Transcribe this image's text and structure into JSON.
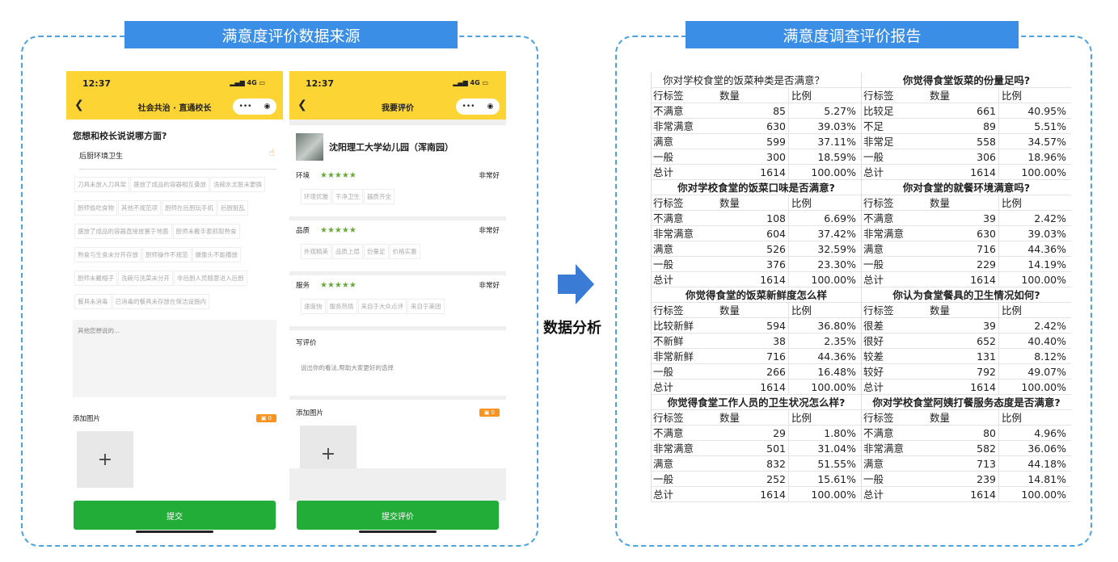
{
  "left_banner": "满意度评价数据来源",
  "right_banner": "满意度调查评价报告",
  "arrow_label": "数据分析",
  "phone1": {
    "time": "12:37",
    "signal": "4G",
    "title": "社会共治 · 直通校长",
    "caps": "•••",
    "question": "您想和校长说说哪方面?",
    "selected": "后厨环境卫生",
    "tags": [
      "刀具未放入刀具架",
      "盛放了成品的容器相互叠放",
      "洗碗水太脏未更换",
      "厨师偷吃食物",
      "其他不规范项",
      "厨师在后厨玩手机",
      "后厨脏乱",
      "盛放了成品的容器直接放置于地面",
      "厨师未戴手套抓取熟食",
      "熟食与生食未分开存放",
      "厨师操作不规范",
      "摄像头不能播放",
      "厨师未戴帽子",
      "洗碗与洗菜未分开",
      "非后厨人员随意进入后厨",
      "餐具未消毒",
      "已消毒的餐具未存放在保洁设施内"
    ],
    "textarea_placeholder": "其他您想说的...",
    "add_image": "添加图片",
    "image_count": "0",
    "plus": "+",
    "submit": "提交"
  },
  "phone2": {
    "time": "12:37",
    "signal": "4G",
    "title": "我要评价",
    "caps": "•••",
    "school": "沈阳理工大学幼儿园（浑南园）",
    "ratings": [
      {
        "label": "环境",
        "stars": "★★★★★",
        "value": "非常好",
        "tags": [
          "环境优雅",
          "干净卫生",
          "器质齐全"
        ]
      },
      {
        "label": "品质",
        "stars": "★★★★★",
        "value": "非常好",
        "tags": [
          "外观精美",
          "品质上层",
          "份量足",
          "价格实惠"
        ]
      },
      {
        "label": "服务",
        "stars": "★★★★★",
        "value": "非常好",
        "tags": [
          "速度快",
          "服务热情",
          "来自于大众点评",
          "来自于美团"
        ]
      }
    ],
    "write_label": "写评价",
    "write_hint": "说出你的看法,帮助大家更好的选择",
    "add_image": "添加图片",
    "image_count": "0",
    "plus": "+",
    "submit": "提交评价"
  },
  "report": {
    "col_headers": [
      "行标签",
      "数量",
      "比例"
    ],
    "left": [
      {
        "title": "你对学校食堂的饭菜种类是否满意？",
        "bold": false,
        "rows": [
          [
            "不满意",
            "85",
            "5.27%"
          ],
          [
            "非常满意",
            "630",
            "39.03%"
          ],
          [
            "满意",
            "599",
            "37.11%"
          ],
          [
            "一般",
            "300",
            "18.59%"
          ],
          [
            "总计",
            "1614",
            "100.00%"
          ]
        ]
      },
      {
        "title": "你对学校食堂的饭菜口味是否满意?",
        "bold": true,
        "rows": [
          [
            "不满意",
            "108",
            "6.69%"
          ],
          [
            "非常满意",
            "604",
            "37.42%"
          ],
          [
            "满意",
            "526",
            "32.59%"
          ],
          [
            "一般",
            "376",
            "23.30%"
          ],
          [
            "总计",
            "1614",
            "100.00%"
          ]
        ]
      },
      {
        "title": "你觉得食堂的饭菜新鲜度怎么样",
        "bold": true,
        "rows": [
          [
            "比较新鲜",
            "594",
            "36.80%"
          ],
          [
            "不新鲜",
            "38",
            "2.35%"
          ],
          [
            "非常新鲜",
            "716",
            "44.36%"
          ],
          [
            "一般",
            "266",
            "16.48%"
          ],
          [
            "总计",
            "1614",
            "100.00%"
          ]
        ]
      },
      {
        "title": "你觉得食堂工作人员的卫生状况怎么样?",
        "bold": true,
        "rows": [
          [
            "不满意",
            "29",
            "1.80%"
          ],
          [
            "非常满意",
            "501",
            "31.04%"
          ],
          [
            "满意",
            "832",
            "51.55%"
          ],
          [
            "一般",
            "252",
            "15.61%"
          ],
          [
            "总计",
            "1614",
            "100.00%"
          ]
        ]
      }
    ],
    "right": [
      {
        "title": "你觉得食堂饭菜的份量足吗?",
        "bold": true,
        "rows": [
          [
            "比较足",
            "661",
            "40.95%"
          ],
          [
            "不足",
            "89",
            "5.51%"
          ],
          [
            "非常足",
            "558",
            "34.57%"
          ],
          [
            "一般",
            "306",
            "18.96%"
          ],
          [
            "总计",
            "1614",
            "100.00%"
          ]
        ]
      },
      {
        "title": "你对食堂的就餐环境满意吗?",
        "bold": true,
        "rows": [
          [
            "不满意",
            "39",
            "2.42%"
          ],
          [
            "非常满意",
            "630",
            "39.03%"
          ],
          [
            "满意",
            "716",
            "44.36%"
          ],
          [
            "一般",
            "229",
            "14.19%"
          ],
          [
            "总计",
            "1614",
            "100.00%"
          ]
        ]
      },
      {
        "title": "你认为食堂餐具的卫生情况如何?",
        "bold": true,
        "rows": [
          [
            "很差",
            "39",
            "2.42%"
          ],
          [
            "很好",
            "652",
            "40.40%"
          ],
          [
            "较差",
            "131",
            "8.12%"
          ],
          [
            "较好",
            "792",
            "49.07%"
          ],
          [
            "总计",
            "1614",
            "100.00%"
          ]
        ]
      },
      {
        "title": "你对学校食堂阿姨打餐服务态度是否满意?",
        "bold": true,
        "rows": [
          [
            "不满意",
            "80",
            "4.96%"
          ],
          [
            "非常满意",
            "582",
            "36.06%"
          ],
          [
            "满意",
            "713",
            "44.18%"
          ],
          [
            "一般",
            "239",
            "14.81%"
          ],
          [
            "总计",
            "1614",
            "100.00%"
          ]
        ]
      }
    ]
  },
  "colors": {
    "banner": "#3a8ee6",
    "dash": "#4aa3df",
    "header_yellow": "#fcd534",
    "submit_green": "#22ac38",
    "star_green": "#6aaa3a",
    "badge_orange": "#f7931e",
    "arrow": "#3a7bd5"
  }
}
